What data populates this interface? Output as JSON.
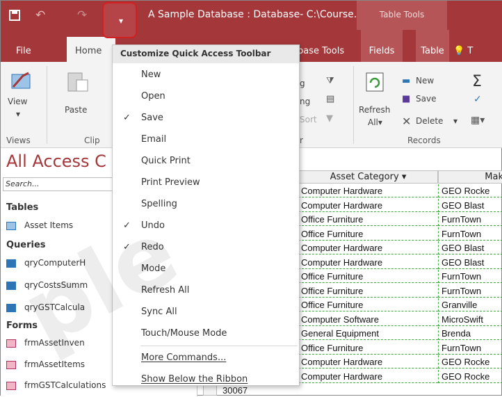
{
  "window": {
    "title": "A Sample Database : Database- C:\\Course...",
    "context_tab_group": "Table Tools"
  },
  "tabs": {
    "file": "File",
    "home": "Home",
    "db_tools": "base Tools",
    "fields": "Fields",
    "table": "Table",
    "tell": "T"
  },
  "ribbon": {
    "view": "View",
    "paste": "Paste",
    "views_group": "Views",
    "clipboard_group": "Clip",
    "sort_a": "g",
    "sort_b": "ng",
    "sort_c": "Sort",
    "sort_group": "r",
    "refresh": "Refresh",
    "refresh_all": "All",
    "new": "New",
    "save": "Save",
    "delete": "Delete",
    "records_group": "Records"
  },
  "nav": {
    "header": "All Access C",
    "search_placeholder": "Search...",
    "groups": [
      "Tables",
      "Queries",
      "Forms"
    ],
    "tables": [
      "Asset Items"
    ],
    "queries": [
      "qryComputerH",
      "qryCostsSumm",
      "qryGSTCalcula"
    ],
    "forms": [
      "frmAssetInven",
      "frmAssetItems",
      "frmGSTCalculations"
    ]
  },
  "qat_menu": {
    "header": "Customize Quick Access Toolbar",
    "items": [
      {
        "label": "New",
        "checked": false
      },
      {
        "label": "Open",
        "checked": false
      },
      {
        "label": "Save",
        "checked": true
      },
      {
        "label": "Email",
        "checked": false
      },
      {
        "label": "Quick Print",
        "checked": false
      },
      {
        "label": "Print Preview",
        "checked": false
      },
      {
        "label": "Spelling",
        "checked": false
      },
      {
        "label": "Undo",
        "checked": true
      },
      {
        "label": "Redo",
        "checked": true
      },
      {
        "label": "Mode",
        "checked": false
      },
      {
        "label": "Refresh All",
        "checked": false
      },
      {
        "label": "Sync All",
        "checked": false
      },
      {
        "label": "Touch/Mouse Mode",
        "checked": false
      }
    ],
    "more": "More Commands...",
    "show_below": "Show Below the Ribbon",
    "check_glyph": "✓"
  },
  "datasheet": {
    "columns": [
      "Asset Category",
      "Mak"
    ],
    "rows": [
      [
        "Computer Hardware",
        "GEO Rocke"
      ],
      [
        "Computer Hardware",
        "GEO Blast"
      ],
      [
        "Office Furniture",
        "FurnTown"
      ],
      [
        "Office Furniture",
        "FurnTown"
      ],
      [
        "Computer Hardware",
        "GEO Blast"
      ],
      [
        "Computer Hardware",
        "GEO Blast"
      ],
      [
        "Office Furniture",
        "FurnTown"
      ],
      [
        "Office Furniture",
        "FurnTown"
      ],
      [
        "Office Furniture",
        "Granville"
      ],
      [
        "Computer Software",
        "MicroSwift"
      ],
      [
        "General Equipment",
        "Brenda"
      ],
      [
        "Office Furniture",
        "FurnTown"
      ],
      [
        "Computer Hardware",
        "GEO Rocke"
      ],
      [
        "Computer Hardware",
        "GEO Rocke"
      ]
    ],
    "last_id": "30067"
  },
  "watermark": "ple",
  "colors": {
    "access_red": "#a4373a",
    "highlight_border": "#d21f1f"
  }
}
